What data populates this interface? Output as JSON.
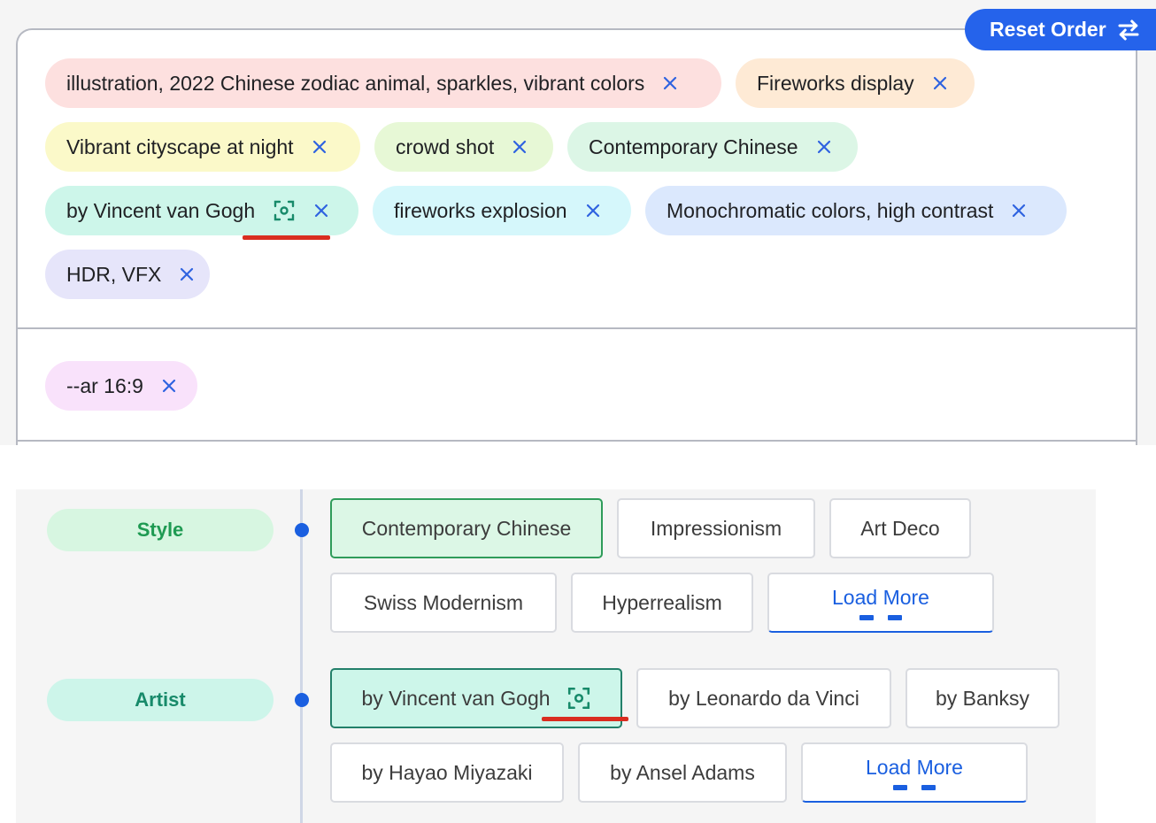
{
  "header": {
    "reset_label": "Reset Order"
  },
  "prompt_chips": [
    {
      "label": "illustration, 2022 Chinese zodiac animal, sparkles, vibrant colors"
    },
    {
      "label": "Fireworks display"
    },
    {
      "label": "Vibrant cityscape at night"
    },
    {
      "label": "crowd shot"
    },
    {
      "label": "Contemporary Chinese"
    },
    {
      "label": "by Vincent van Gogh"
    },
    {
      "label": "fireworks explosion"
    },
    {
      "label": "Monochromatic colors, high contrast"
    },
    {
      "label": "HDR, VFX"
    }
  ],
  "param_chips": [
    {
      "label": "--ar 16:9"
    }
  ],
  "categories": [
    {
      "name": "Style",
      "options": [
        "Contemporary Chinese",
        "Impressionism",
        "Art Deco",
        "Swiss Modernism",
        "Hyperrealism"
      ],
      "selected": "Contemporary Chinese",
      "load_more_label": "Load More"
    },
    {
      "name": "Artist",
      "options": [
        "by Vincent van Gogh",
        "by Leonardo da Vinci",
        "by Banksy",
        "by Hayao Miyazaki",
        "by Ansel Adams"
      ],
      "selected": "by Vincent van Gogh",
      "load_more_label": "Load More"
    }
  ],
  "colors": {
    "accent": "#2563eb",
    "highlight_underline": "#d92d20",
    "style_text": "#1e9a52",
    "artist_text": "#178a6a"
  },
  "icons": {
    "remove": "close-icon",
    "reset": "swap-arrows-icon",
    "focus": "focus-scan-icon"
  }
}
